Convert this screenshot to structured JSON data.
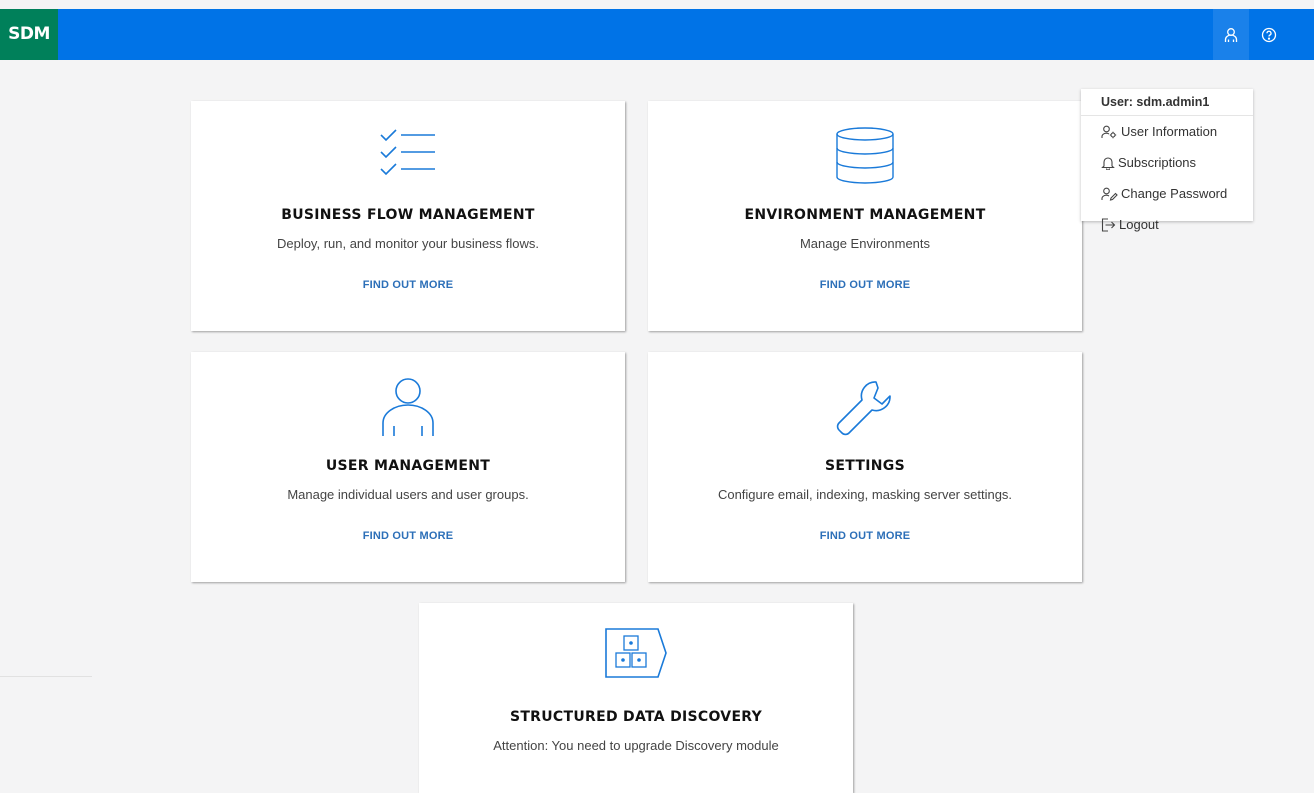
{
  "header": {
    "logo": "SDM",
    "icons": [
      "user-icon",
      "help-icon"
    ]
  },
  "user_menu": {
    "username": "User: sdm.admin1",
    "items": [
      {
        "label": "User Information",
        "icon": "user-settings-icon"
      },
      {
        "label": "Subscriptions",
        "icon": "bell-icon"
      },
      {
        "label": "Change Password",
        "icon": "user-edit-icon"
      },
      {
        "label": "Logout",
        "icon": "logout-icon"
      }
    ]
  },
  "cards": [
    {
      "title": "BUSINESS FLOW MANAGEMENT",
      "description": "Deploy, run, and monitor your business flows.",
      "link": "FIND OUT MORE",
      "icon": "checklist-icon"
    },
    {
      "title": "ENVIRONMENT MANAGEMENT",
      "description": "Manage Environments",
      "link": "FIND OUT MORE",
      "icon": "database-icon"
    },
    {
      "title": "USER MANAGEMENT",
      "description": "Manage individual users and user groups.",
      "link": "FIND OUT MORE",
      "icon": "user-icon"
    },
    {
      "title": "SETTINGS",
      "description": "Configure email, indexing, masking server settings.",
      "link": "FIND OUT MORE",
      "icon": "wrench-icon"
    },
    {
      "title": "STRUCTURED DATA DISCOVERY",
      "description": "Attention: You need to upgrade Discovery module",
      "icon": "data-discovery-icon"
    }
  ],
  "colors": {
    "header": "#0073e7",
    "logo_bg": "#00805a",
    "accent_icon": "#1a7ad9",
    "link": "#2c6fb8",
    "page_bg": "#f4f4f5"
  }
}
